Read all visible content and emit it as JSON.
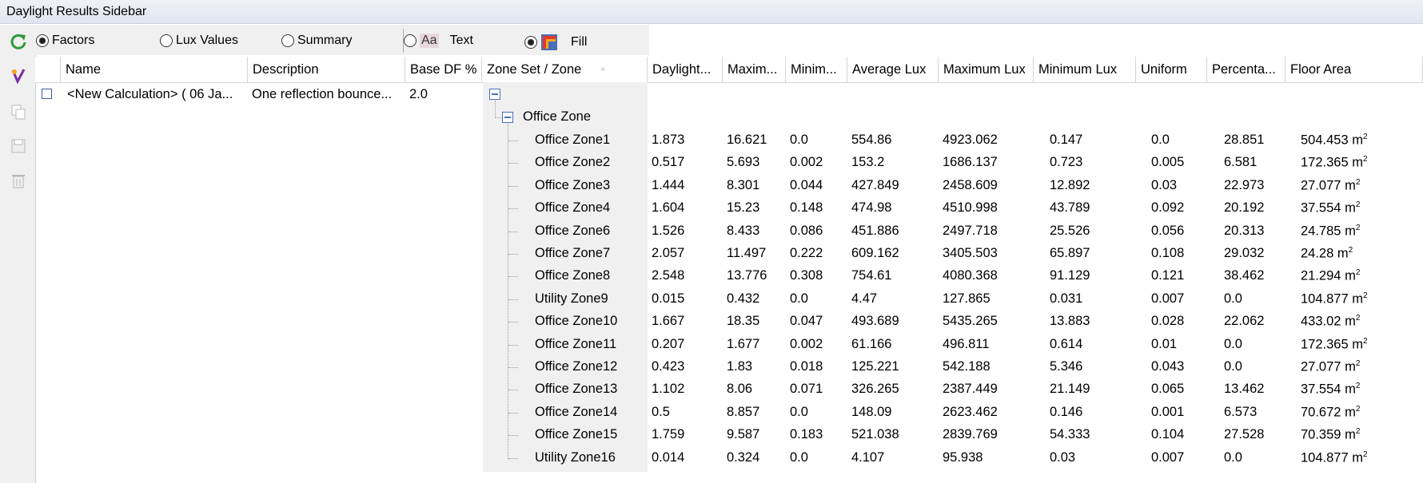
{
  "window": {
    "title": "Daylight Results Sidebar"
  },
  "toolbar": {
    "radios": [
      {
        "label": "Factors",
        "checked": true
      },
      {
        "label": "Lux Values",
        "checked": false
      },
      {
        "label": "Summary",
        "checked": false
      },
      {
        "label": "Text",
        "checked": false
      },
      {
        "label": "Fill",
        "checked": true
      }
    ],
    "text_icon_glyph": "Aa"
  },
  "columns": [
    "Name",
    "Description",
    "Base DF %",
    "Zone Set / Zone",
    "Daylight...",
    "Maxim...",
    "Minim...",
    "Average Lux",
    "Maximum Lux",
    "Minimum Lux",
    "Uniform",
    "Percenta...",
    "Floor Area"
  ],
  "sort_indicator": "^",
  "calculation": {
    "name": "<New Calculation> ( 06 Ja...",
    "description": "One reflection bounce...",
    "base_df": "2.0",
    "zone_set": "Office Zone",
    "area_unit": "m",
    "area_exp": "2"
  },
  "zones": [
    {
      "name": "Office Zone1",
      "df": "1.873",
      "max": "16.621",
      "min": "0.0",
      "avg_lux": "554.86",
      "max_lux": "4923.062",
      "min_lux": "0.147",
      "uniform": "0.0",
      "pct": "28.851",
      "area": "504.453"
    },
    {
      "name": "Office Zone2",
      "df": "0.517",
      "max": "5.693",
      "min": "0.002",
      "avg_lux": "153.2",
      "max_lux": "1686.137",
      "min_lux": "0.723",
      "uniform": "0.005",
      "pct": "6.581",
      "area": "172.365"
    },
    {
      "name": "Office Zone3",
      "df": "1.444",
      "max": "8.301",
      "min": "0.044",
      "avg_lux": "427.849",
      "max_lux": "2458.609",
      "min_lux": "12.892",
      "uniform": "0.03",
      "pct": "22.973",
      "area": "27.077"
    },
    {
      "name": "Office Zone4",
      "df": "1.604",
      "max": "15.23",
      "min": "0.148",
      "avg_lux": "474.98",
      "max_lux": "4510.998",
      "min_lux": "43.789",
      "uniform": "0.092",
      "pct": "20.192",
      "area": "37.554"
    },
    {
      "name": "Office Zone6",
      "df": "1.526",
      "max": "8.433",
      "min": "0.086",
      "avg_lux": "451.886",
      "max_lux": "2497.718",
      "min_lux": "25.526",
      "uniform": "0.056",
      "pct": "20.313",
      "area": "24.785"
    },
    {
      "name": "Office Zone7",
      "df": "2.057",
      "max": "11.497",
      "min": "0.222",
      "avg_lux": "609.162",
      "max_lux": "3405.503",
      "min_lux": "65.897",
      "uniform": "0.108",
      "pct": "29.032",
      "area": "24.28"
    },
    {
      "name": "Office Zone8",
      "df": "2.548",
      "max": "13.776",
      "min": "0.308",
      "avg_lux": "754.61",
      "max_lux": "4080.368",
      "min_lux": "91.129",
      "uniform": "0.121",
      "pct": "38.462",
      "area": "21.294"
    },
    {
      "name": "Utility Zone9",
      "df": "0.015",
      "max": "0.432",
      "min": "0.0",
      "avg_lux": "4.47",
      "max_lux": "127.865",
      "min_lux": "0.031",
      "uniform": "0.007",
      "pct": "0.0",
      "area": "104.877"
    },
    {
      "name": "Office Zone10",
      "df": "1.667",
      "max": "18.35",
      "min": "0.047",
      "avg_lux": "493.689",
      "max_lux": "5435.265",
      "min_lux": "13.883",
      "uniform": "0.028",
      "pct": "22.062",
      "area": "433.02"
    },
    {
      "name": "Office Zone11",
      "df": "0.207",
      "max": "1.677",
      "min": "0.002",
      "avg_lux": "61.166",
      "max_lux": "496.811",
      "min_lux": "0.614",
      "uniform": "0.01",
      "pct": "0.0",
      "area": "172.365"
    },
    {
      "name": "Office Zone12",
      "df": "0.423",
      "max": "1.83",
      "min": "0.018",
      "avg_lux": "125.221",
      "max_lux": "542.188",
      "min_lux": "5.346",
      "uniform": "0.043",
      "pct": "0.0",
      "area": "27.077"
    },
    {
      "name": "Office Zone13",
      "df": "1.102",
      "max": "8.06",
      "min": "0.071",
      "avg_lux": "326.265",
      "max_lux": "2387.449",
      "min_lux": "21.149",
      "uniform": "0.065",
      "pct": "13.462",
      "area": "37.554"
    },
    {
      "name": "Office Zone14",
      "df": "0.5",
      "max": "8.857",
      "min": "0.0",
      "avg_lux": "148.09",
      "max_lux": "2623.462",
      "min_lux": "0.146",
      "uniform": "0.001",
      "pct": "6.573",
      "area": "70.672"
    },
    {
      "name": "Office Zone15",
      "df": "1.759",
      "max": "9.587",
      "min": "0.183",
      "avg_lux": "521.038",
      "max_lux": "2839.769",
      "min_lux": "54.333",
      "uniform": "0.104",
      "pct": "27.528",
      "area": "70.359"
    },
    {
      "name": "Utility Zone16",
      "df": "0.014",
      "max": "0.324",
      "min": "0.0",
      "avg_lux": "4.107",
      "max_lux": "95.938",
      "min_lux": "0.03",
      "uniform": "0.007",
      "pct": "0.0",
      "area": "104.877"
    }
  ],
  "icons": {
    "refresh": "refresh-icon",
    "add_calc": "add-calculation-icon",
    "copy": "copy-icon",
    "save": "save-icon",
    "delete": "delete-icon"
  },
  "colors": {
    "refresh": "#2e9b3a",
    "accent": "#4a6fb5",
    "fill_red": "#e23a2a"
  }
}
